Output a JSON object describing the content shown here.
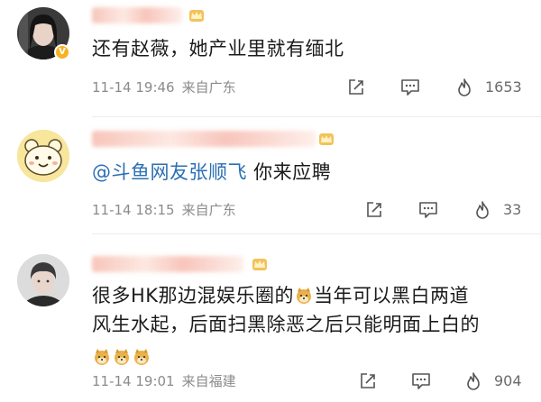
{
  "comments": [
    {
      "text": "还有赵薇，她产业里就有缅北",
      "time": "11-14 19:46",
      "location": "来自广东",
      "likes": "1653"
    },
    {
      "mention": "@斗鱼网友张顺飞",
      "text": " 你来应聘",
      "time": "11-14 18:15",
      "location": "来自广东",
      "likes": "33"
    },
    {
      "text_line1_a": "很多HK那边混娱乐圈的",
      "text_line1_b": "当年可以黑白两道",
      "text_line2": "风生水起，后面扫黑除恶之后只能明面上白的",
      "time": "11-14 19:01",
      "location": "来自福建",
      "likes": "904"
    }
  ],
  "icons": {
    "share": "share-icon",
    "comment": "comment-icon",
    "like": "flame-like-icon",
    "verified": "verified-badge-icon",
    "crown": "crown-badge-icon",
    "doge": "doge-emoji-icon"
  },
  "colors": {
    "mention": "#2b6fb3",
    "meta": "#8b8b8b",
    "badge": "#f6b324"
  }
}
